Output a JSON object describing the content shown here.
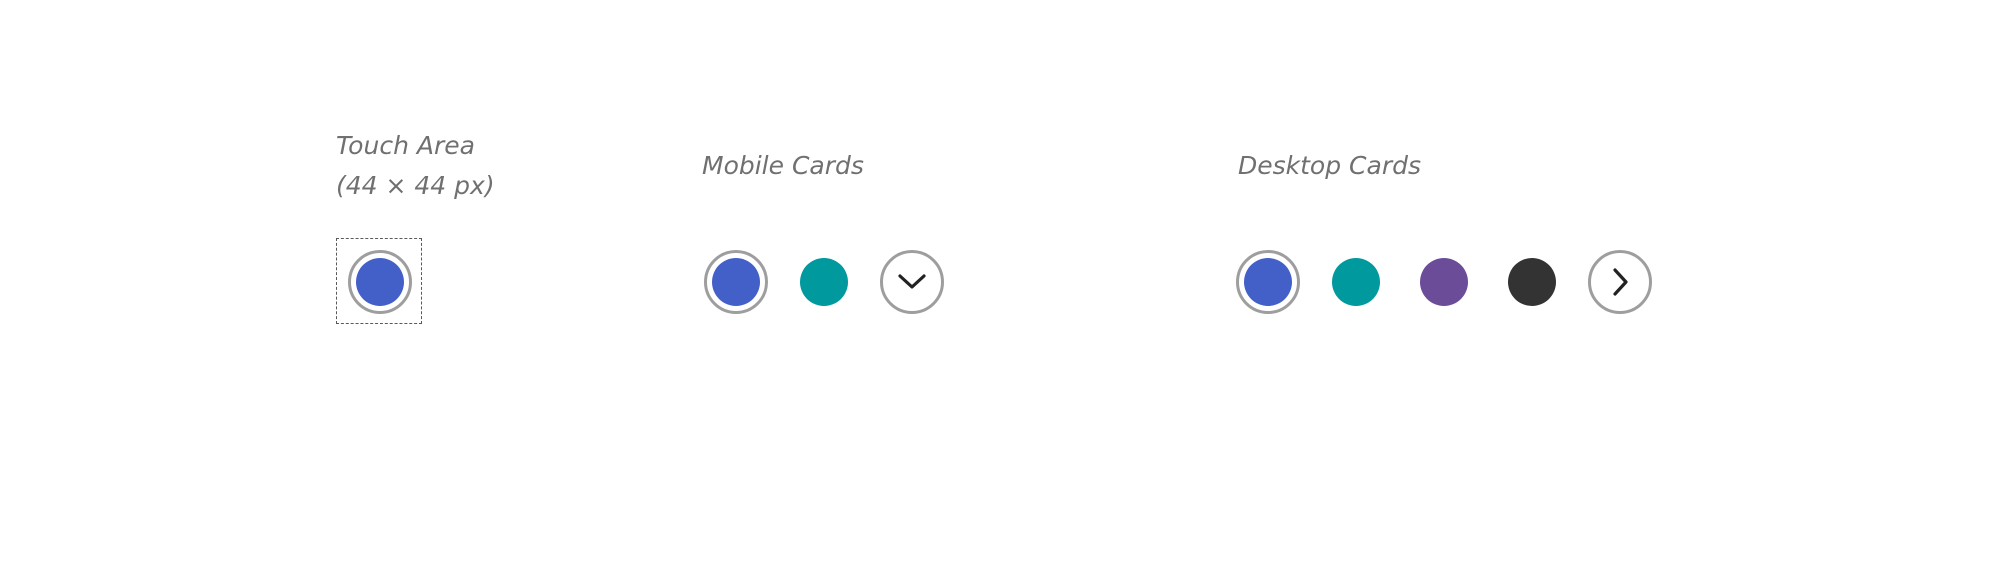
{
  "sections": {
    "touch_area": {
      "title_line1": "Touch Area",
      "title_line2": "(44 × 44 px)"
    },
    "mobile": {
      "title": "Mobile Cards",
      "next_button_icon": "chevron-down-icon"
    },
    "desktop": {
      "title": "Desktop Cards",
      "next_button_icon": "chevron-right-icon"
    }
  },
  "colors": {
    "blue": "#4360c9",
    "teal": "#00999e",
    "purple": "#6a4c98",
    "dark": "#333333",
    "ring": "#9e9e9e",
    "label": "#707070"
  }
}
